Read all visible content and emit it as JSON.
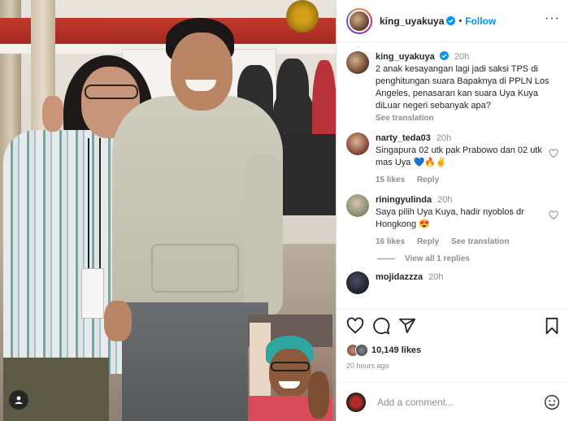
{
  "post": {
    "username": "king_uyakuya",
    "follow_label": "Follow",
    "dot": "•",
    "more": "···"
  },
  "caption": {
    "username": "king_uyakuya",
    "time": "20h",
    "text": "2 anak kesayangan lagi jadi saksi TPS di penghitungan suara Bapaknya di PPLN Los Angeles, penasaran kan suara Uya Kuya diLuar negeri sebanyak apa?",
    "see_translation": "See translation"
  },
  "comments": [
    {
      "username": "narty_teda03",
      "time": "20h",
      "text": "Singapura 02 utk pak Prabowo dan 02 utk mas Uya 💙🔥✌️",
      "likes": "15 likes",
      "reply": "Reply"
    },
    {
      "username": "riningyulinda",
      "time": "20h",
      "text": "Saya pilih Uya Kuya, hadir nyoblos dr Hongkong 😍",
      "likes": "16 likes",
      "reply": "Reply",
      "see_translation": "See translation"
    },
    {
      "username": "mojidazzza",
      "time": "20h"
    }
  ],
  "view_replies": "View all 1 replies",
  "stats": {
    "likes": "10,149 likes",
    "ago": "20 hours ago"
  },
  "add_comment": {
    "placeholder": "Add a comment..."
  },
  "colors": {
    "follow_blue": "#0095f6",
    "verified_blue": "#0095f6",
    "muted": "#8e8e8e"
  }
}
